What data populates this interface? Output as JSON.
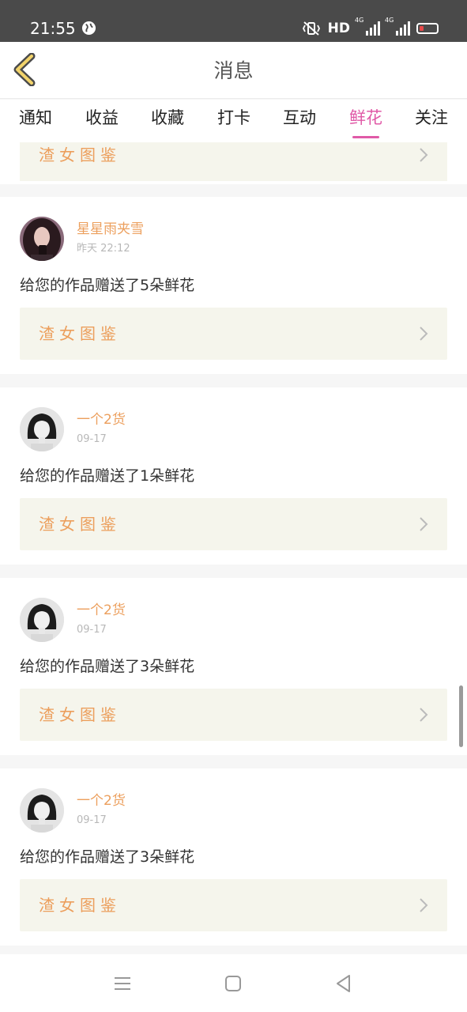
{
  "status_bar": {
    "time": "21:55",
    "network_label": "HD",
    "signal_1_label": "4G",
    "signal_2_label": "4G",
    "battery_level": 0.15
  },
  "header": {
    "title": "消息"
  },
  "tabs": [
    {
      "label": "通知",
      "active": false
    },
    {
      "label": "收益",
      "active": false
    },
    {
      "label": "收藏",
      "active": false
    },
    {
      "label": "打卡",
      "active": false
    },
    {
      "label": "互动",
      "active": false
    },
    {
      "label": "鲜花",
      "active": true
    },
    {
      "label": "关注",
      "active": false
    }
  ],
  "partial_item": {
    "work_title": "渣女图鉴"
  },
  "items": [
    {
      "username": "星星雨夹雪",
      "time": "昨天 22:12",
      "message": "给您的作品赠送了5朵鲜花",
      "work_title": "渣女图鉴",
      "avatar_icon": "girl-dark-hair-avatar"
    },
    {
      "username": "一个2货",
      "time": "09-17",
      "message": "给您的作品赠送了1朵鲜花",
      "work_title": "渣女图鉴",
      "avatar_icon": "grayscale-girl-avatar"
    },
    {
      "username": "一个2货",
      "time": "09-17",
      "message": "给您的作品赠送了3朵鲜花",
      "work_title": "渣女图鉴",
      "avatar_icon": "grayscale-girl-avatar"
    },
    {
      "username": "一个2货",
      "time": "09-17",
      "message": "给您的作品赠送了3朵鲜花",
      "work_title": "渣女图鉴",
      "avatar_icon": "grayscale-girl-avatar"
    }
  ],
  "colors": {
    "accent_pink": "#e05aa7",
    "username_orange": "#ec9f5d",
    "work_bg": "#f5f5ec"
  }
}
